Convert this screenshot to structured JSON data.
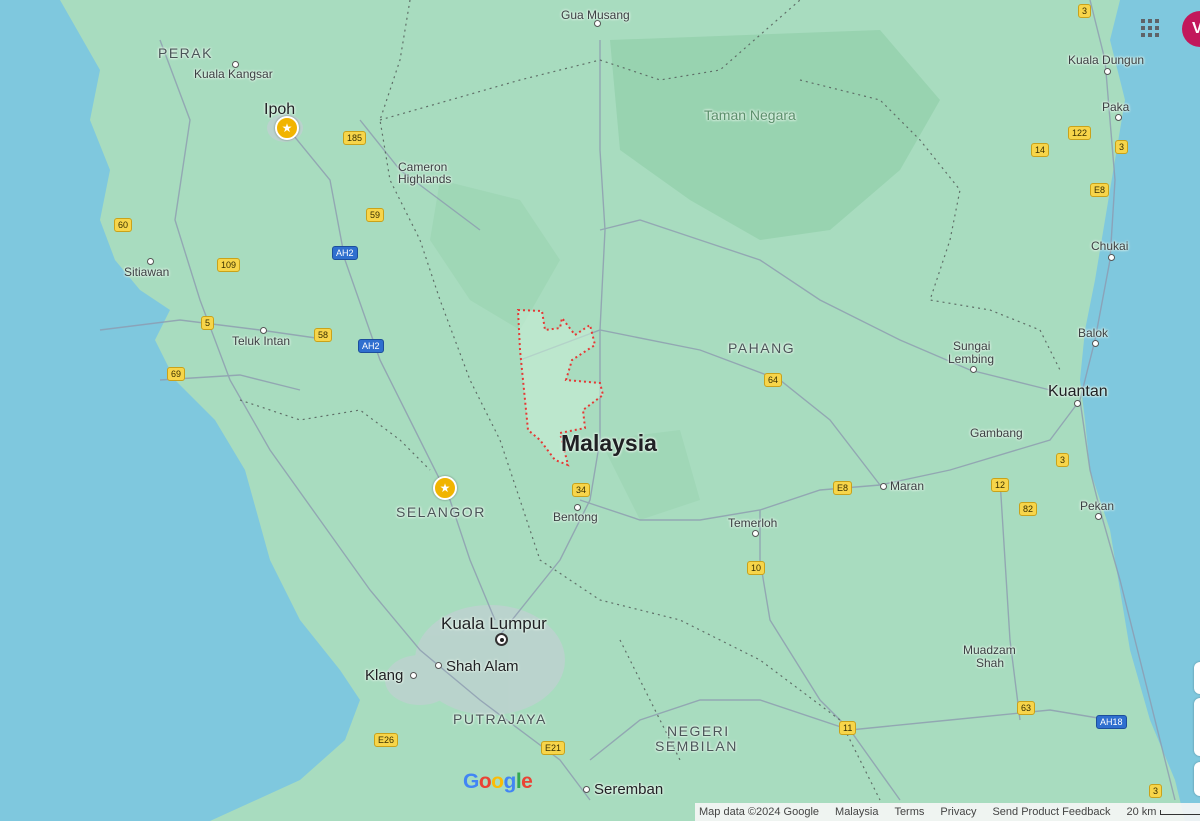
{
  "colors": {
    "water": "#7fc8de",
    "land": "#a8dcbf",
    "boundary": "#555555",
    "highlight": "#e53935",
    "route_shield": "#f7d54a",
    "asian_highway": "#2f6fcf"
  },
  "labels": {
    "country": "Malaysia",
    "park": "Taman Negara",
    "states": {
      "perak": "PERAK",
      "pahang": "PAHANG",
      "selangor": "SELANGOR",
      "putrajaya": "PUTRAJAYA",
      "negeri_sembilan_1": "NEGERI",
      "negeri_sembilan_2": "SEMBILAN"
    },
    "cities": {
      "gua_musang": "Gua Musang",
      "kuala_kangsar": "Kuala Kangsar",
      "ipoh": "Ipoh",
      "cameron_1": "Cameron",
      "cameron_2": "Highlands",
      "sitiawan": "Sitiawan",
      "teluk_intan": "Teluk Intan",
      "kuala_dungun": "Kuala Dungun",
      "paka": "Paka",
      "chukai": "Chukai",
      "balok": "Balok",
      "sungai_lembing_1": "Sungai",
      "sungai_lembing_2": "Lembing",
      "kuantan": "Kuantan",
      "gambang": "Gambang",
      "maran": "Maran",
      "pekan": "Pekan",
      "temerloh": "Temerloh",
      "bentong": "Bentong",
      "kuala_lumpur": "Kuala Lumpur",
      "shah_alam": "Shah Alam",
      "klang": "Klang",
      "seremban": "Seremban",
      "muadzam_1": "Muadzam",
      "muadzam_2": "Shah"
    }
  },
  "shields": {
    "r3a": "3",
    "r185": "185",
    "r122": "122",
    "r14": "14",
    "r3b": "3",
    "rE8a": "E8",
    "r60": "60",
    "r59": "59",
    "rAH2a": "AH2",
    "r109": "109",
    "r5": "5",
    "r58": "58",
    "rAH2b": "AH2",
    "r69": "69",
    "r64": "64",
    "r34": "34",
    "rE8b": "E8",
    "r12": "12",
    "r82": "82",
    "r3c": "3",
    "r10": "10",
    "r11": "11",
    "r63": "63",
    "rAH18": "AH18",
    "rE26": "E26",
    "rE21": "E21",
    "r3d": "3"
  },
  "controls": {
    "apps_icon": "apps-grid-icon",
    "avatar_letter": "V"
  },
  "google_logo": [
    "G",
    "o",
    "o",
    "g",
    "l",
    "e"
  ],
  "attribution": {
    "map_data": "Map data ©2024 Google",
    "region": "Malaysia",
    "terms": "Terms",
    "privacy": "Privacy",
    "feedback": "Send Product Feedback",
    "scale": "20 km"
  }
}
